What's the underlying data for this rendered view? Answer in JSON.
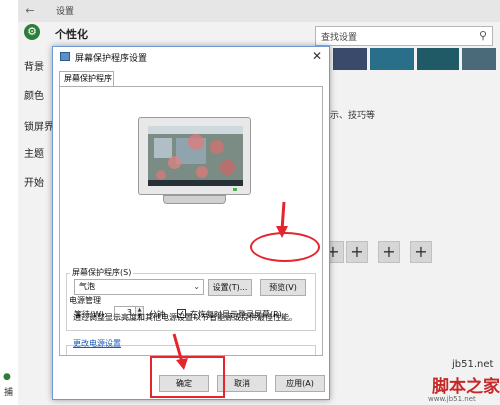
{
  "settings": {
    "window_title": "设置",
    "page_heading": "个性化",
    "search_placeholder": "查找设置",
    "nav_items": [
      "背景",
      "颜色",
      "锁屏界",
      "主题",
      "开始"
    ],
    "hint_text": "示、技巧等",
    "plus_label": "+",
    "bottom_text": "捕"
  },
  "dialog": {
    "title": "屏幕保护程序设置",
    "tab": "屏幕保护程序",
    "screensaver_group_label": "屏幕保护程序(S)",
    "selected_screensaver": "气泡",
    "settings_button": "设置(T)...",
    "preview_button": "预览(V)",
    "wait_label": "等待(W):",
    "wait_value": "3",
    "minutes_label": "分钟",
    "resume_checkbox_label": "在恢复时显示登录屏幕(R)",
    "resume_checked": true,
    "power_group_label": "电源管理",
    "power_description": "通过调整显示亮度和其他电源设置以节省能源或提供最佳性能。",
    "power_link": "更改电源设置",
    "ok_button": "确定",
    "cancel_button": "取消",
    "apply_button": "应用(A)"
  },
  "watermark": {
    "line1": "jb51.net",
    "line2": "脚本之家",
    "line3": "www.jb51.net"
  },
  "colors": {
    "annotation_red": "#e3262d",
    "link_blue": "#1a5bb8",
    "accent_green": "#2d7d3a"
  }
}
